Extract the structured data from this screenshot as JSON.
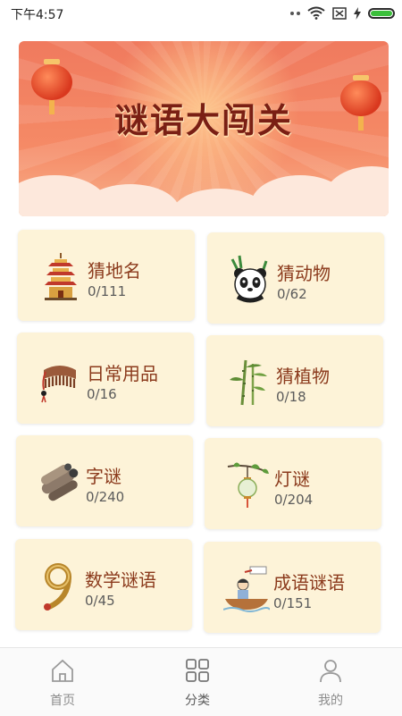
{
  "status": {
    "time": "下午4:57"
  },
  "banner": {
    "title": "谜语大闯关"
  },
  "categories": [
    {
      "name": "猜地名",
      "progress": "0/111",
      "icon": "pagoda-icon"
    },
    {
      "name": "猜动物",
      "progress": "0/62",
      "icon": "panda-icon"
    },
    {
      "name": "日常用品",
      "progress": "0/16",
      "icon": "comb-icon"
    },
    {
      "name": "猜植物",
      "progress": "0/18",
      "icon": "bamboo-icon"
    },
    {
      "name": "字谜",
      "progress": "0/240",
      "icon": "scroll-icon"
    },
    {
      "name": "灯谜",
      "progress": "0/204",
      "icon": "lantern-icon"
    },
    {
      "name": "数学谜语",
      "progress": "0/45",
      "icon": "number-nine-icon"
    },
    {
      "name": "成语谜语",
      "progress": "0/151",
      "icon": "boat-icon"
    }
  ],
  "tabs": [
    {
      "label": "首页",
      "icon": "home-icon"
    },
    {
      "label": "分类",
      "icon": "grid-icon",
      "active": true
    },
    {
      "label": "我的",
      "icon": "user-icon"
    }
  ],
  "colors": {
    "card_bg": "#fdf3d8",
    "title": "#8b3a1c",
    "banner": "#f07a5e"
  }
}
